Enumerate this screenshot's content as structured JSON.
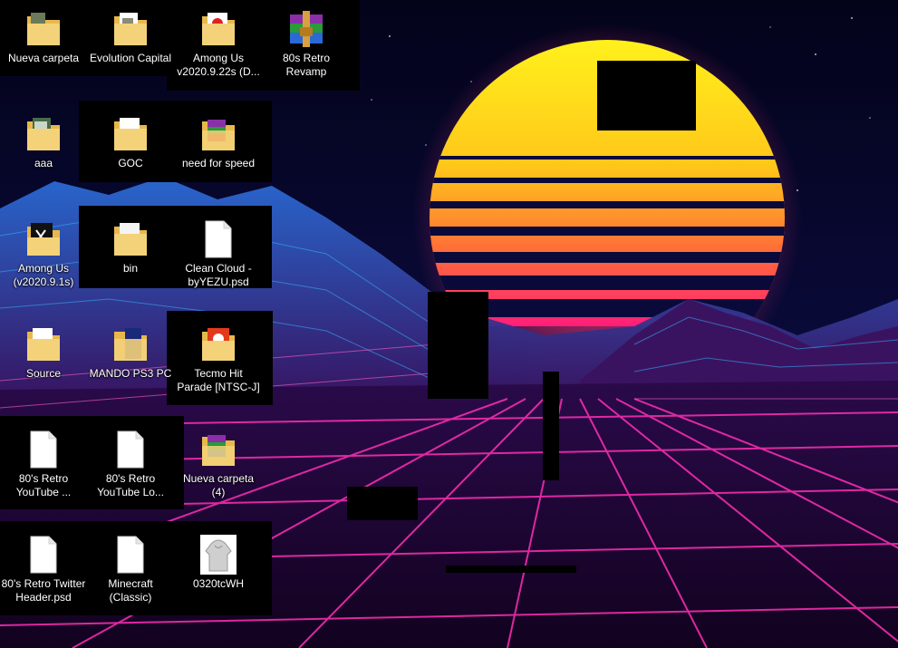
{
  "desktop": {
    "icons": [
      {
        "label": "Nueva carpeta",
        "icon": "folder-icon"
      },
      {
        "label": "Evolution Capital",
        "icon": "folder-icon"
      },
      {
        "label": "Among Us v2020.9.22s (D...",
        "icon": "folder-icon"
      },
      {
        "label": "80s Retro Revamp",
        "icon": "winrar-archive-icon"
      },
      {
        "label": "aaa",
        "icon": "folder-icon"
      },
      {
        "label": "GOC",
        "icon": "folder-icon"
      },
      {
        "label": "need for speed",
        "icon": "winrar-folder-icon"
      },
      {
        "label": "Among Us (v2020.9.1s)",
        "icon": "folder-icon"
      },
      {
        "label": "bin",
        "icon": "folder-icon"
      },
      {
        "label": "Clean Cloud - byYEZU.psd",
        "icon": "blank-file-icon"
      },
      {
        "label": "Source",
        "icon": "folder-icon"
      },
      {
        "label": "MANDO PS3 PC",
        "icon": "folder-icon"
      },
      {
        "label": "Tecmo Hit Parade [NTSC-J]",
        "icon": "folder-icon"
      },
      {
        "label": "80's Retro YouTube ...",
        "icon": "blank-file-icon"
      },
      {
        "label": "80's Retro YouTube Lo...",
        "icon": "blank-file-icon"
      },
      {
        "label": "Nueva carpeta (4)",
        "icon": "winrar-folder-icon"
      },
      {
        "label": "80's Retro Twitter Header.psd",
        "icon": "blank-file-icon"
      },
      {
        "label": "Minecraft (Classic)",
        "icon": "blank-file-icon"
      },
      {
        "label": "0320tcWH",
        "icon": "hoodie-image-icon"
      }
    ]
  },
  "colors": {
    "sun_top": "#ffee22",
    "sun_bottom": "#ff2e6a",
    "grid_pink": "#ff2fb5",
    "grid_blue": "#2f9cff",
    "sky": "#05041a"
  }
}
